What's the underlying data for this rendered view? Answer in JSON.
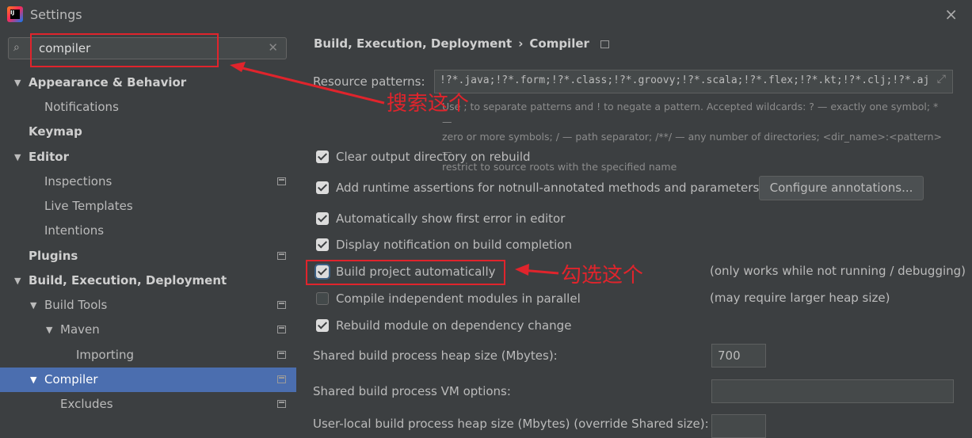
{
  "window": {
    "title": "Settings",
    "app_icon": "intellij-icon",
    "close": "×"
  },
  "search": {
    "value": "compiler",
    "icon": "search-icon",
    "clear": "✕"
  },
  "tree": [
    {
      "label": "Appearance & Behavior",
      "bold": true,
      "arrow": "down"
    },
    {
      "label": "Notifications",
      "bold": false
    },
    {
      "label": "Keymap",
      "bold": true
    },
    {
      "label": "Editor",
      "bold": true,
      "arrow": "down"
    },
    {
      "label": "Inspections",
      "bold": false,
      "project": true
    },
    {
      "label": "Live Templates",
      "bold": false
    },
    {
      "label": "Intentions",
      "bold": false
    },
    {
      "label": "Plugins",
      "bold": true,
      "project": true
    },
    {
      "label": "Build, Execution, Deployment",
      "bold": true,
      "arrow": "down"
    },
    {
      "label": "Build Tools",
      "bold": false,
      "arrow": "down",
      "project": true
    },
    {
      "label": "Maven",
      "bold": false,
      "arrow": "down",
      "project": true
    },
    {
      "label": "Importing",
      "bold": false,
      "project": true
    },
    {
      "label": "Compiler",
      "bold": false,
      "arrow": "down",
      "project": true,
      "selected": true
    },
    {
      "label": "Excludes",
      "bold": false,
      "project": true
    }
  ],
  "breadcrumb": {
    "part1": "Build, Execution, Deployment",
    "separator": "›",
    "part2": "Compiler"
  },
  "resource": {
    "label": "Resource patterns:",
    "value": "!?*.java;!?*.form;!?*.class;!?*.groovy;!?*.scala;!?*.flex;!?*.kt;!?*.clj;!?*.aj",
    "help_line1": "Use ; to separate patterns and ! to negate a pattern. Accepted wildcards: ? — exactly one symbol; * —",
    "help_line2": "zero or more symbols; / — path separator; /**/ — any number of directories; <dir_name>:<pattern> —",
    "help_line3": "restrict to source roots with the specified name"
  },
  "options": [
    {
      "label": "Clear output directory on rebuild",
      "checked": true
    },
    {
      "label": "Add runtime assertions for notnull-annotated methods and parameters",
      "checked": true
    },
    {
      "label": "Automatically show first error in editor",
      "checked": true
    },
    {
      "label": "Display notification on build completion",
      "checked": true
    },
    {
      "label": "Build project automatically",
      "checked": true
    },
    {
      "label": "Compile independent modules in parallel",
      "checked": false
    },
    {
      "label": "Rebuild module on dependency change",
      "checked": true
    }
  ],
  "configure_button": "Configure annotations...",
  "notes": {
    "build_auto": "(only works while not running / debugging)",
    "parallel": "(may require larger heap size)"
  },
  "heap": {
    "label": "Shared build process heap size (Mbytes):",
    "value": "700"
  },
  "vm": {
    "label": "Shared build process VM options:",
    "value": ""
  },
  "cut_off_label": "User-local build process heap size (Mbytes) (override Shared size):",
  "annotations": {
    "search_note": "搜索这个",
    "check_note": "勾选这个",
    "color": "#e0242c"
  }
}
